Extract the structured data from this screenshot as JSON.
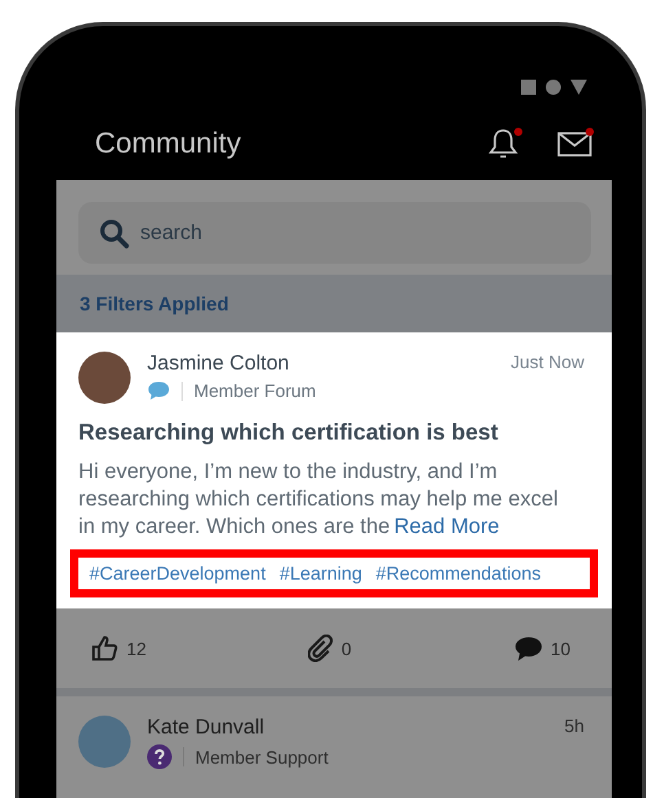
{
  "app_bar": {
    "title": "Community",
    "notifications_unread": true,
    "messages_unread": true
  },
  "search": {
    "placeholder": "search"
  },
  "filters": {
    "label": "3 Filters Applied"
  },
  "posts": [
    {
      "author": "Jasmine Colton",
      "kind": "chat",
      "channel": "Member Forum",
      "time": "Just Now",
      "highlighted": true,
      "title": "Researching which certification is best",
      "body": "Hi everyone, I’m new to the industry, and I’m researching which certifications may help me excel in my career. Which ones are the",
      "read_more": "Read More",
      "tags_outlined": true,
      "tags": [
        "#CareerDevelopment",
        "#Learning",
        "#Recommendations"
      ],
      "likes": "12",
      "attachments": "0",
      "comments": "10"
    },
    {
      "author": "Kate Dunvall",
      "kind": "question",
      "channel": "Member Support",
      "time": "5h",
      "highlighted": false
    }
  ]
}
